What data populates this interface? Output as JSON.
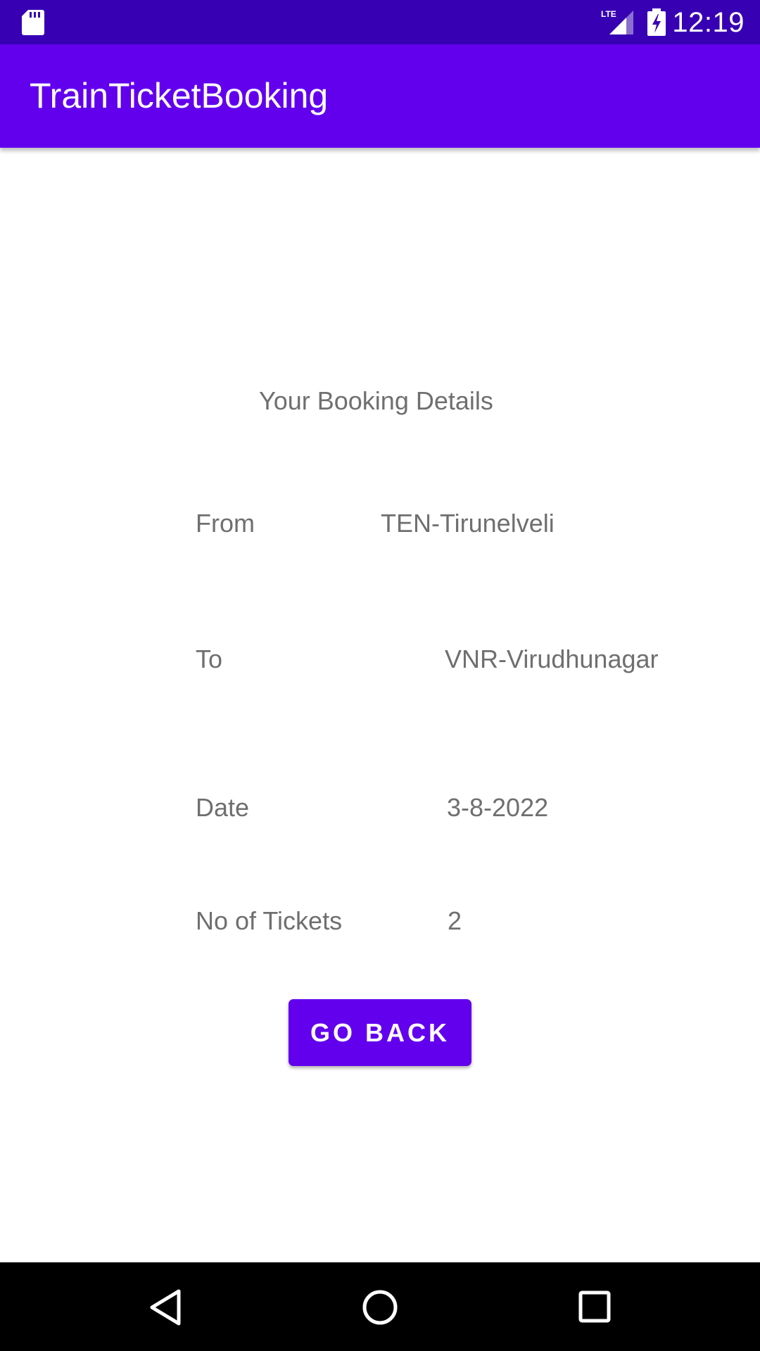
{
  "status_bar": {
    "time": "12:19",
    "network": "LTE",
    "icons": [
      "sd-card-icon",
      "lte-signal-icon",
      "battery-charging-icon"
    ]
  },
  "app_bar": {
    "title": "TrainTicketBooking"
  },
  "booking": {
    "heading": "Your Booking Details",
    "from_label": "From",
    "from_value": "TEN-Tirunelveli",
    "to_label": "To",
    "to_value": "VNR-Virudhunagar",
    "date_label": "Date",
    "date_value": "3-8-2022",
    "tickets_label": "No of Tickets",
    "tickets_value": "2"
  },
  "actions": {
    "go_back_label": "GO BACK"
  },
  "nav_bar": {
    "icons": [
      "back-icon",
      "home-icon",
      "recents-icon"
    ]
  },
  "colors": {
    "status_bar": "#3700b3",
    "primary": "#6200ee",
    "text_secondary": "#6f6f6f",
    "nav_bar": "#000000"
  }
}
